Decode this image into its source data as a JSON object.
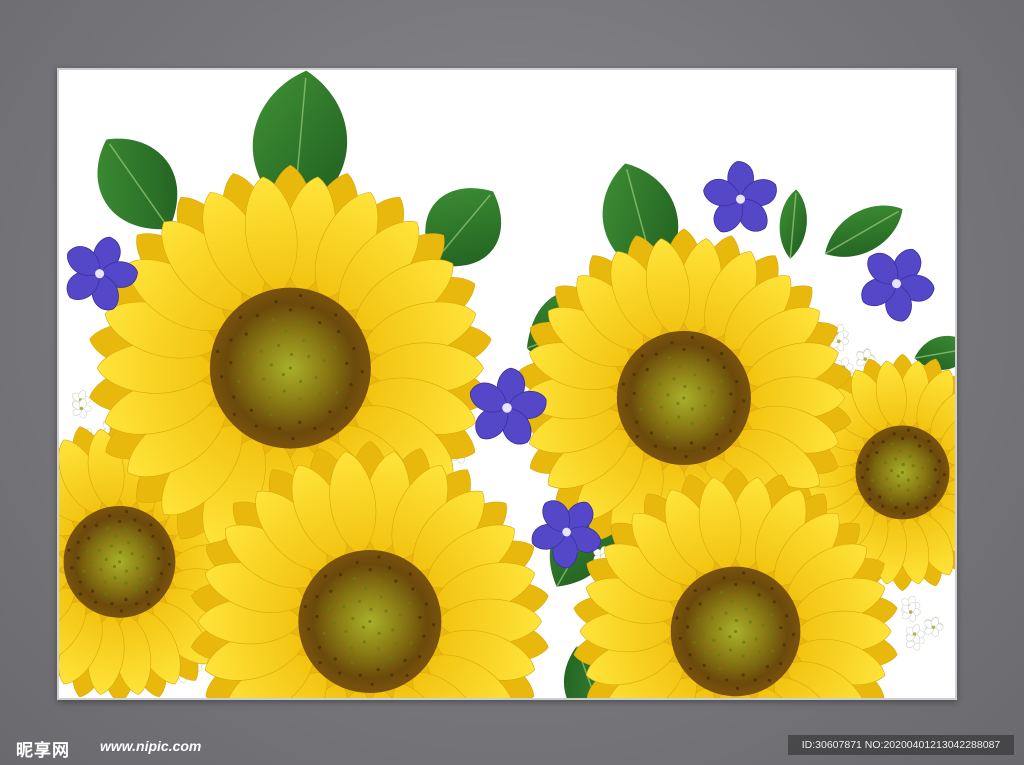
{
  "watermark": {
    "logo_text": "昵享网",
    "url": "www.nipic.com",
    "id_line": "ID:30607871 NO:20200401213042288087"
  },
  "colors": {
    "background": "#76767a",
    "petal": "#f7d417",
    "petal_dark": "#e9b80c",
    "disc": "#6b4a0b",
    "disc_inner": "#8f9a1d",
    "leaf": "#2f7a2a",
    "periwinkle": "#5548c8",
    "white_blossom": "#ffffff"
  },
  "image": {
    "subject_icons": [
      "sunflower-icon",
      "periwinkle-icon",
      "leaf-icon",
      "white-blossom-icon"
    ]
  }
}
